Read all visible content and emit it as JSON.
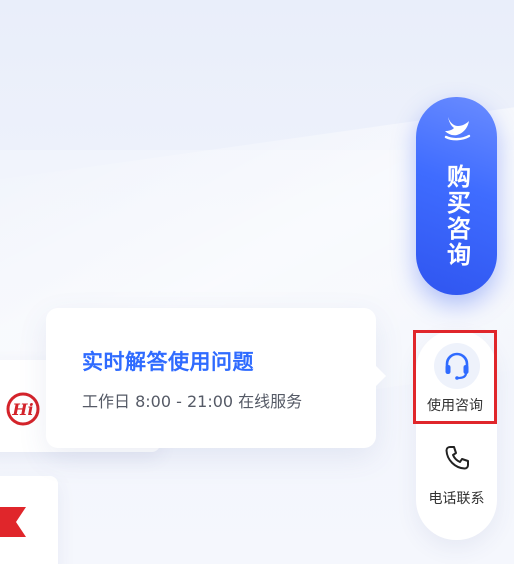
{
  "tooltip": {
    "title": "实时解答使用问题",
    "subtitle": "工作日 8:00 - 21:00 在线服务"
  },
  "buy_button": {
    "label": "购买咨询",
    "icon": "brand-bird-logo-icon"
  },
  "service_panel": {
    "consult": {
      "label": "使用咨询",
      "icon": "headset-icon",
      "highlight_color": "#e0262b"
    },
    "phone": {
      "label": "电话联系",
      "icon": "phone-icon"
    }
  },
  "left_cards": {
    "hi_logo": {
      "text": "Hi",
      "icon": "hi-brand-logo-icon"
    },
    "flag": {
      "icon": "red-flag-icon"
    }
  },
  "colors": {
    "accent_blue": "#2f6bff",
    "buy_gradient_start": "#6a8cff",
    "buy_gradient_end": "#2f55f0",
    "brand_red": "#e0262b"
  }
}
